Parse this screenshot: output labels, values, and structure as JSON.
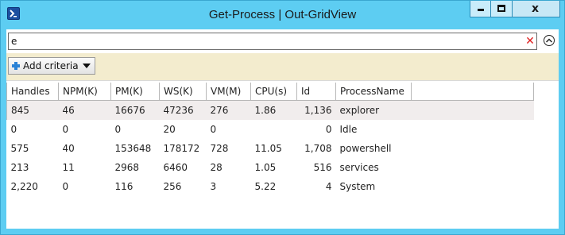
{
  "window": {
    "title": "Get-Process | Out-GridView",
    "icon": "powershell-icon",
    "buttons": {
      "minimize": "minimize-icon",
      "maximize": "maximize-icon",
      "close": "x"
    },
    "accent_color": "#5dcdf2"
  },
  "search": {
    "value": "e",
    "clear_color": "#e02020"
  },
  "criteria": {
    "add_label": "Add criteria"
  },
  "grid": {
    "columns": [
      "Handles",
      "NPM(K)",
      "PM(K)",
      "WS(K)",
      "VM(M)",
      "CPU(s)",
      "Id",
      "ProcessName"
    ],
    "rows": [
      {
        "handles": "845",
        "npm": "46",
        "pm": "16676",
        "ws": "47236",
        "vm": "276",
        "cpu": "1.86",
        "id": "1,136",
        "name": "explorer",
        "selected": true
      },
      {
        "handles": "0",
        "npm": "0",
        "pm": "0",
        "ws": "20",
        "vm": "0",
        "cpu": "",
        "id": "0",
        "name": "Idle",
        "selected": false
      },
      {
        "handles": "575",
        "npm": "40",
        "pm": "153648",
        "ws": "178172",
        "vm": "728",
        "cpu": "11.05",
        "id": "1,708",
        "name": "powershell",
        "selected": false
      },
      {
        "handles": "213",
        "npm": "11",
        "pm": "2968",
        "ws": "6460",
        "vm": "28",
        "cpu": "1.05",
        "id": "516",
        "name": "services",
        "selected": false
      },
      {
        "handles": "2,220",
        "npm": "0",
        "pm": "116",
        "ws": "256",
        "vm": "3",
        "cpu": "5.22",
        "id": "4",
        "name": "System",
        "selected": false
      }
    ]
  }
}
